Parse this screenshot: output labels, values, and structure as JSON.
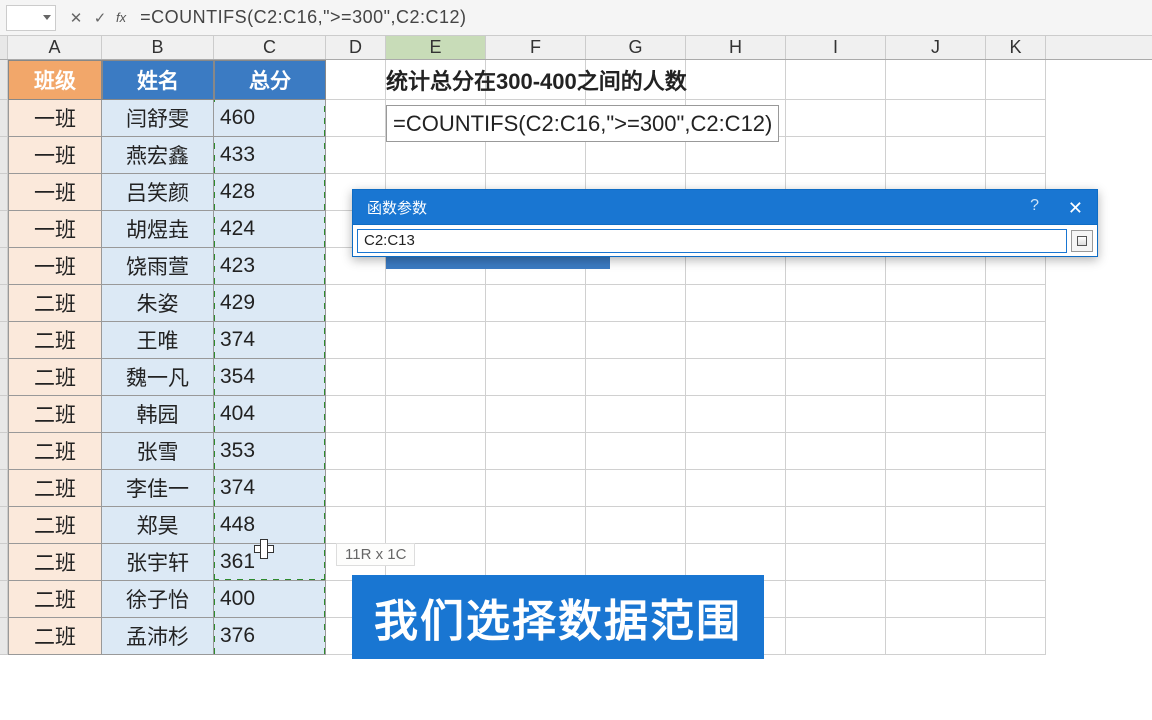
{
  "formula_bar": {
    "formula": "=COUNTIFS(C2:C16,\">=300\",C2:C12)",
    "fx_label": "fx"
  },
  "columns": [
    "A",
    "B",
    "C",
    "D",
    "E",
    "F",
    "G",
    "H",
    "I",
    "J",
    "K"
  ],
  "headers": {
    "A": "班级",
    "B": "姓名",
    "C": "总分"
  },
  "table": [
    {
      "class": "一班",
      "name": "闫舒雯",
      "score": "460"
    },
    {
      "class": "一班",
      "name": "燕宏鑫",
      "score": "433"
    },
    {
      "class": "一班",
      "name": "吕笑颜",
      "score": "428"
    },
    {
      "class": "一班",
      "name": "胡煜垚",
      "score": "424"
    },
    {
      "class": "一班",
      "name": "饶雨萱",
      "score": "423"
    },
    {
      "class": "二班",
      "name": "朱姿",
      "score": "429"
    },
    {
      "class": "二班",
      "name": "王唯",
      "score": "374"
    },
    {
      "class": "二班",
      "name": "魏一凡",
      "score": "354"
    },
    {
      "class": "二班",
      "name": "韩园",
      "score": "404"
    },
    {
      "class": "二班",
      "name": "张雪",
      "score": "353"
    },
    {
      "class": "二班",
      "name": "李佳一",
      "score": "374"
    },
    {
      "class": "二班",
      "name": "郑昊",
      "score": "448"
    },
    {
      "class": "二班",
      "name": "张宇轩",
      "score": "361"
    },
    {
      "class": "二班",
      "name": "徐子怡",
      "score": "400"
    },
    {
      "class": "二班",
      "name": "孟沛杉",
      "score": "376"
    }
  ],
  "e1_text": "统计总分在300-400之间的人数",
  "e2_formula": "=COUNTIFS(C2:C16,\">=300\",C2:C12)",
  "fn_dialog": {
    "title": "函数参数",
    "input_value": "C2:C13",
    "help": "?",
    "close": "✕"
  },
  "selection_tooltip": "11R x 1C",
  "caption": "我们选择数据范围",
  "chart_data": {
    "type": "table",
    "title": "统计总分在300-400之间的人数",
    "columns": [
      "班级",
      "姓名",
      "总分"
    ],
    "rows": [
      [
        "一班",
        "闫舒雯",
        460
      ],
      [
        "一班",
        "燕宏鑫",
        433
      ],
      [
        "一班",
        "吕笑颜",
        428
      ],
      [
        "一班",
        "胡煜垚",
        424
      ],
      [
        "一班",
        "饶雨萱",
        423
      ],
      [
        "二班",
        "朱姿",
        429
      ],
      [
        "二班",
        "王唯",
        374
      ],
      [
        "二班",
        "魏一凡",
        354
      ],
      [
        "二班",
        "韩园",
        404
      ],
      [
        "二班",
        "张雪",
        353
      ],
      [
        "二班",
        "李佳一",
        374
      ],
      [
        "二班",
        "郑昊",
        448
      ],
      [
        "二班",
        "张宇轩",
        361
      ],
      [
        "二班",
        "徐子怡",
        400
      ],
      [
        "二班",
        "孟沛杉",
        376
      ]
    ]
  }
}
